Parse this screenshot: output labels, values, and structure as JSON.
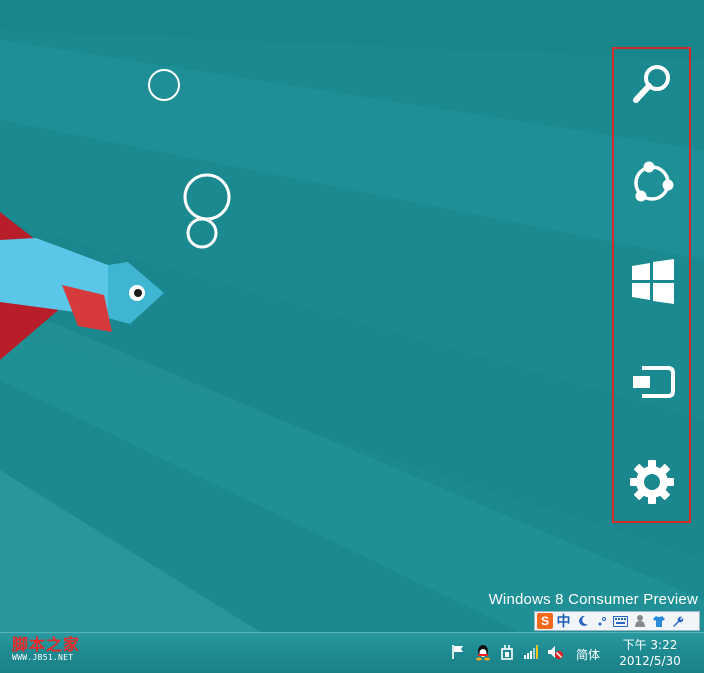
{
  "charms": [
    {
      "id": "search",
      "icon": "search-icon"
    },
    {
      "id": "share",
      "icon": "share-icon"
    },
    {
      "id": "start",
      "icon": "windows-logo-icon"
    },
    {
      "id": "devices",
      "icon": "devices-icon"
    },
    {
      "id": "settings",
      "icon": "gear-icon"
    }
  ],
  "colors": {
    "background": "#1a8a90",
    "charm_highlight_border": "#d42a2a",
    "fish_body": "#5bc7e8",
    "fish_fin": "#c0202a"
  },
  "watermark": "Windows 8 Consumer Preview",
  "ime_toolbar": {
    "logo": "S",
    "mode": "中",
    "icons": [
      "moon-icon",
      "punctuation-icon",
      "keyboard-icon",
      "user-icon",
      "shirt-icon",
      "wrench-icon"
    ]
  },
  "taskbar": {
    "site_logo": "脚本之家",
    "site_url": "WWW.JB51.NET",
    "tray_icons": [
      "flag-icon",
      "qq-icon",
      "power-icon",
      "network-icon",
      "volume-muted-icon"
    ],
    "language": "简体",
    "clock": {
      "time": "下午 3:22",
      "date": "2012/5/30"
    }
  }
}
